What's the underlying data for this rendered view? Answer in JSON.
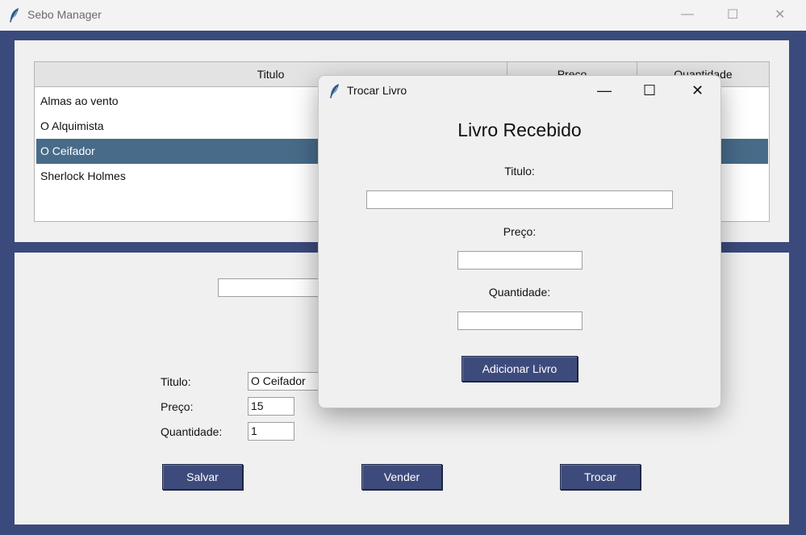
{
  "app": {
    "title": "Sebo Manager",
    "controls": {
      "minimize": "—",
      "maximize": "☐",
      "close": "✕"
    }
  },
  "table": {
    "columns": [
      "Titulo",
      "Preço",
      "Quantidade"
    ],
    "rows": [
      "Almas ao vento",
      "O Alquimista",
      "O Ceifador",
      "Sherlock Holmes"
    ],
    "selected": "O Ceifador"
  },
  "search": {
    "value": ""
  },
  "form": {
    "titulo_label": "Titulo:",
    "titulo_value": "O Ceifador",
    "preco_label": "Preço:",
    "preco_value": "15",
    "quantidade_label": "Quantidade:",
    "quantidade_value": "1"
  },
  "buttons": {
    "salvar": "Salvar",
    "vender": "Vender",
    "trocar": "Trocar"
  },
  "dialog": {
    "title": "Trocar Livro",
    "heading": "Livro Recebido",
    "titulo_label": "Titulo:",
    "preco_label": "Preço:",
    "quantidade_label": "Quantidade:",
    "titulo_value": "",
    "preco_value": "",
    "quantidade_value": "",
    "add_button": "Adicionar Livro",
    "controls": {
      "minimize": "—",
      "maximize": "☐",
      "close": "✕"
    }
  },
  "colors": {
    "frame": "#3b4a7c",
    "button": "#3d4b7c",
    "selection": "#476b89"
  }
}
